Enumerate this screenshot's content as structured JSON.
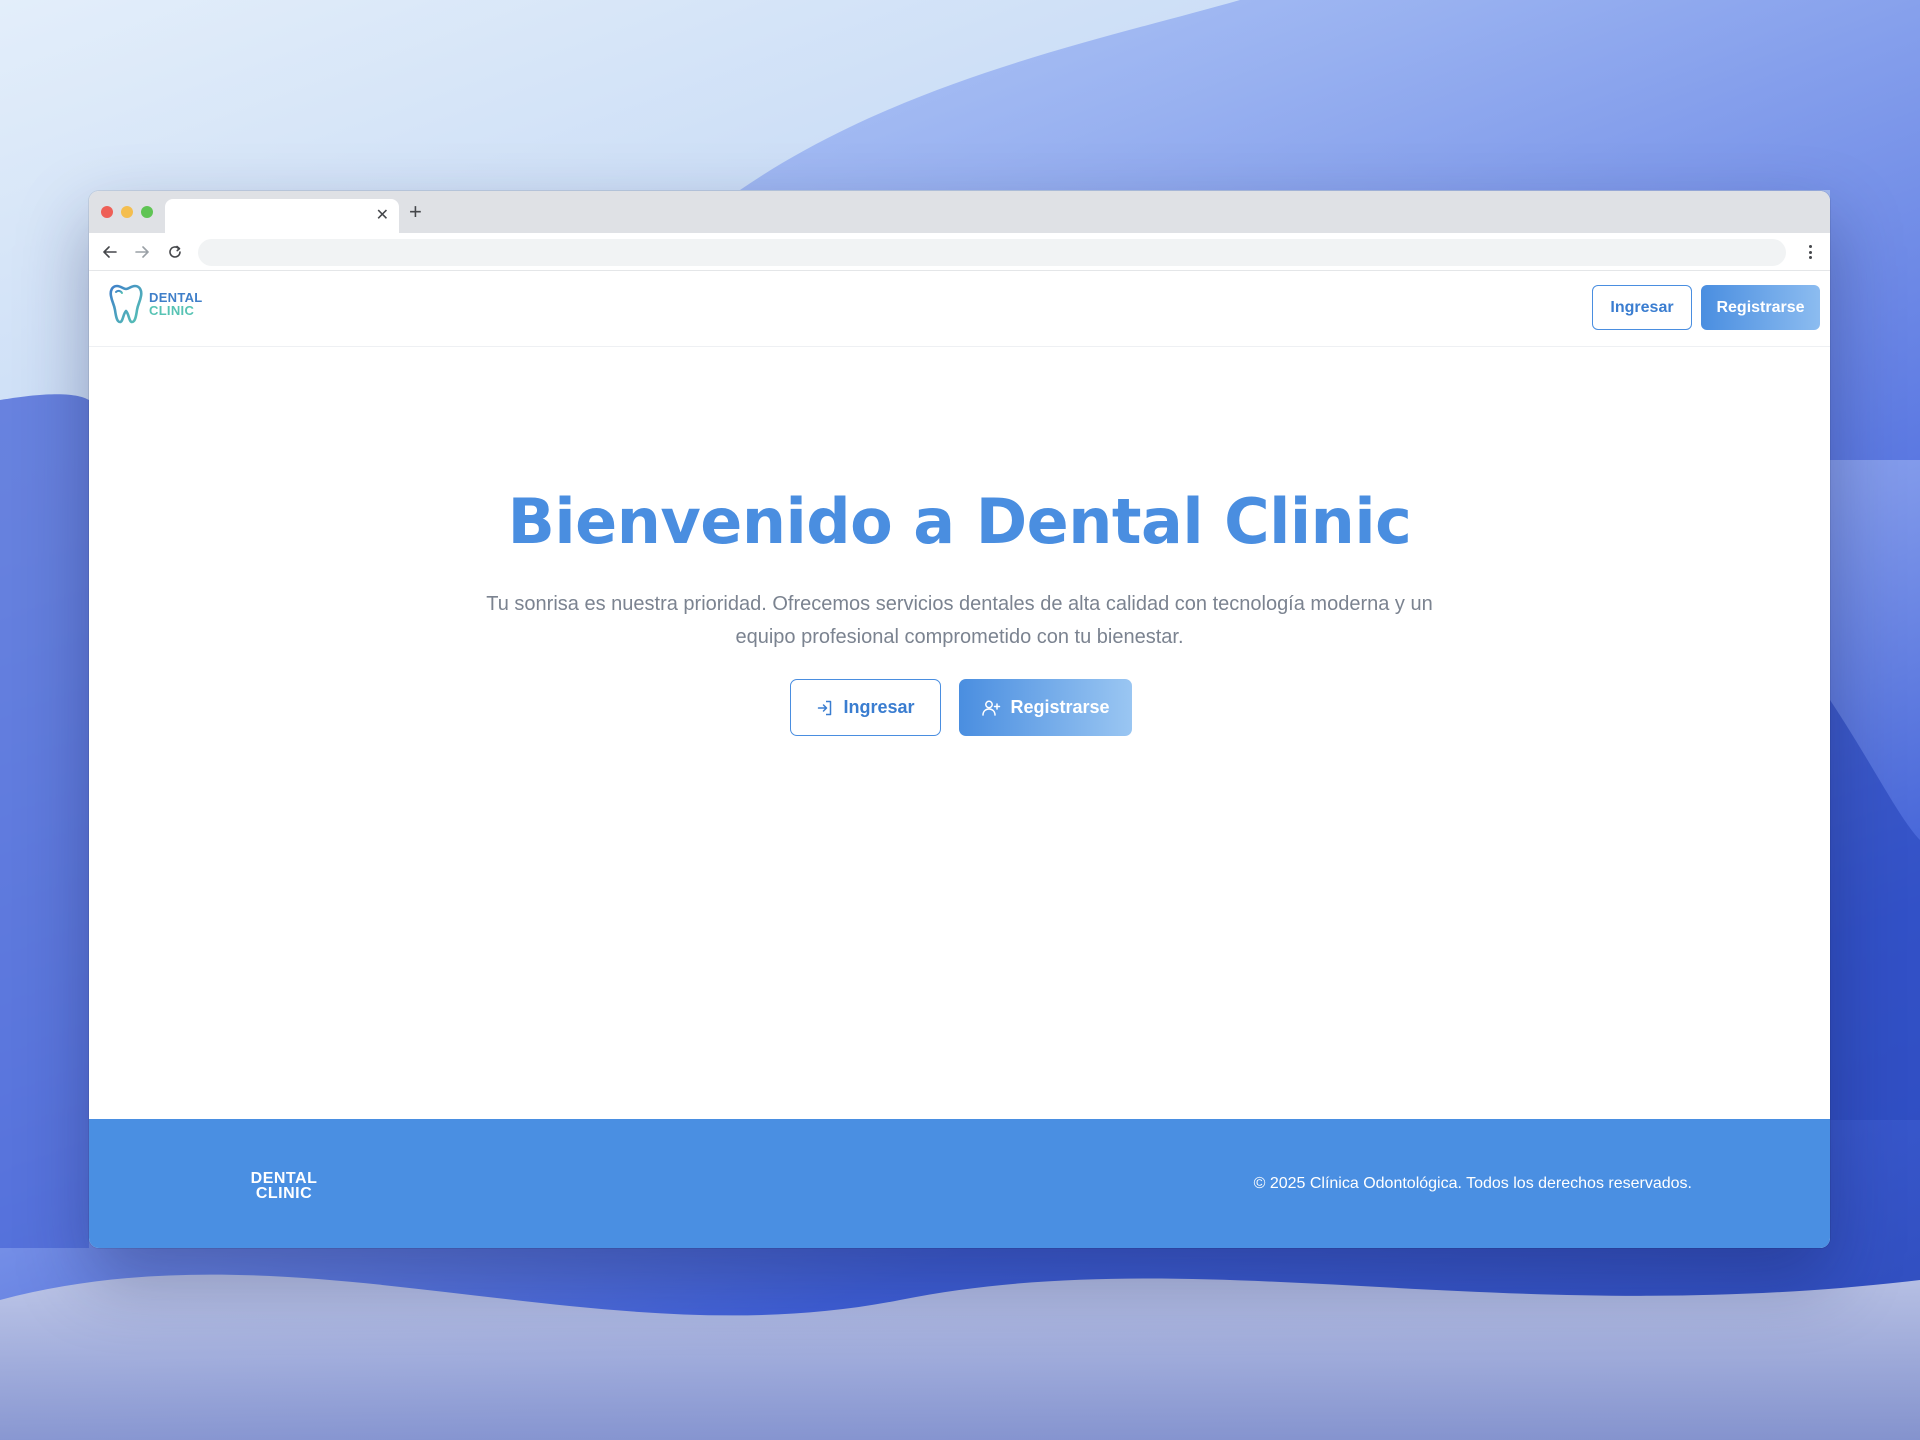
{
  "browser": {
    "tab_title": "",
    "tab_close": "✕",
    "new_tab": "+",
    "url": ""
  },
  "header": {
    "logo_line1": "DENTAL",
    "logo_line2": "CLINIC",
    "login_label": "Ingresar",
    "register_label": "Registrarse"
  },
  "hero": {
    "title": "Bienvenido a Dental Clinic",
    "subtitle": "Tu sonrisa es nuestra prioridad. Ofrecemos servicios dentales de alta calidad con tecnología moderna y un equipo profesional comprometido con tu bienestar.",
    "login_label": "Ingresar",
    "register_label": "Registrarse"
  },
  "footer": {
    "logo_line1": "DENTAL",
    "logo_line2": "CLINIC",
    "copyright": "© 2025 Clínica Odontológica. Todos los derechos reservados."
  },
  "colors": {
    "brand_blue": "#4a8ee0",
    "brand_teal": "#57c3b4",
    "footer_bg": "#4a8fe2",
    "text_muted": "#7b8390"
  },
  "icons": {
    "logo": "tooth-icon",
    "hero_login": "login-icon",
    "hero_register": "user-plus-icon"
  }
}
